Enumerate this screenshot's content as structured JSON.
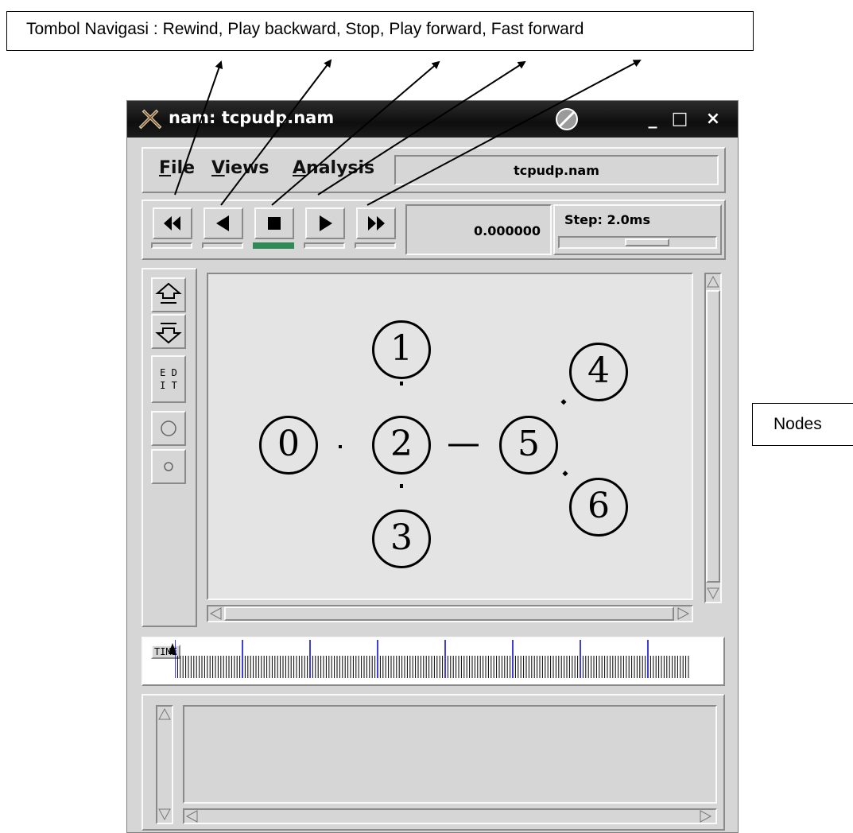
{
  "annotations": {
    "nav_label": "Tombol Navigasi : Rewind, Play backward, Stop, Play forward, Fast forward",
    "nodes_label": "Nodes"
  },
  "window": {
    "title": "nam: tcpudp.nam",
    "controls": {
      "minimize": "_",
      "maximize": "□",
      "close": "×"
    }
  },
  "menubar": {
    "items": [
      {
        "label": "File",
        "mnemonic": "F",
        "rest": "ile"
      },
      {
        "label": "Views",
        "mnemonic": "V",
        "rest": "iews"
      },
      {
        "label": "Analysis",
        "mnemonic": "A",
        "rest": "nalysis"
      }
    ],
    "filename": "tcpudp.nam"
  },
  "toolbar": {
    "buttons": [
      "Rewind",
      "Play backward",
      "Stop",
      "Play forward",
      "Fast forward"
    ],
    "active_indicator_color": "#2e8b57",
    "time_value": "0.000000",
    "step_label": "Step: 2.0ms"
  },
  "side_tools": {
    "edit_label_line1": "E D",
    "edit_label_line2": "I T"
  },
  "nodes": [
    "0",
    "1",
    "2",
    "3",
    "4",
    "5",
    "6"
  ],
  "timeline": {
    "label": "TIME",
    "major_tick_color": "#0000cc"
  }
}
